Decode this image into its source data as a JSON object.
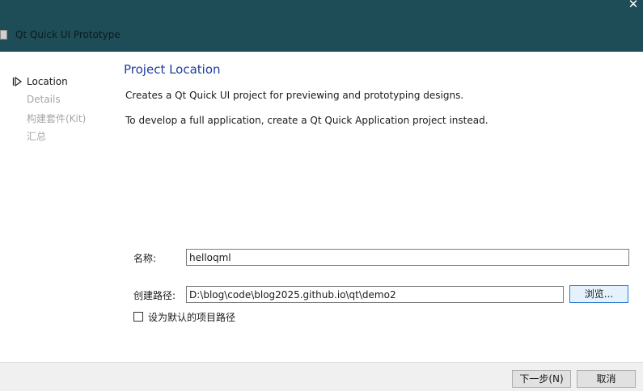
{
  "window": {
    "title": "Qt Quick UI Prototype",
    "close_glyph": "✕",
    "app_icon": "app-icon"
  },
  "steps": [
    {
      "label": "Location",
      "state": "active"
    },
    {
      "label": "Details",
      "state": "inactive"
    },
    {
      "label": "构建套件(Kit)",
      "state": "inactive"
    },
    {
      "label": "汇总",
      "state": "inactive"
    }
  ],
  "main": {
    "title": "Project Location",
    "desc1": "Creates a Qt Quick UI project for previewing and prototyping designs.",
    "desc2": "To develop a full application, create a Qt Quick Application project instead."
  },
  "form": {
    "name_label": "名称:",
    "name_value": "helloqml",
    "path_label": "创建路径:",
    "path_value": "D:\\blog\\code\\blog2025.github.io\\qt\\demo2",
    "browse_label": "浏览...",
    "default_checkbox_label": "设为默认的项目路径",
    "default_checked": false
  },
  "footer": {
    "next_label": "下一步(N)",
    "cancel_label": "取消"
  },
  "colors": {
    "titlebar": "#1e4d57",
    "heading": "#1e3e9e",
    "inactive_step": "#a5a5a5",
    "focus_border": "#2b7bd4"
  }
}
